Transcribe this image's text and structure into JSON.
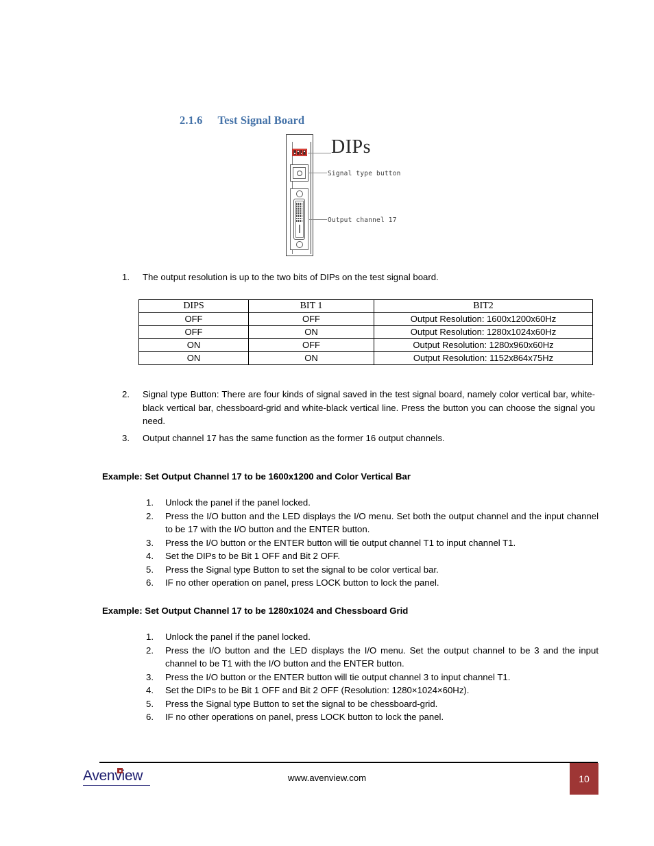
{
  "heading": {
    "number": "2.1.6",
    "title": "Test Signal Board"
  },
  "diagram": {
    "dips_title": "DIPs",
    "label_signal_button": "Signal type button",
    "label_output_channel": "Output channel 17"
  },
  "main_list": [
    {
      "marker": "1.",
      "text": "The output resolution is up to the two bits of DIPs on the test signal board."
    },
    {
      "marker": "2.",
      "text": "Signal type Button: There are four kinds of signal saved in the test signal board, namely color vertical bar, white-black vertical bar, chessboard-grid and white-black vertical line. Press the button you can choose the signal you need."
    },
    {
      "marker": "3.",
      "text": "Output channel 17 has the same function as the former 16 output channels."
    }
  ],
  "table": {
    "headers": [
      "DIPS",
      "BIT 1",
      "BIT2"
    ],
    "rows": [
      [
        "OFF",
        "OFF",
        "Output Resolution: 1600x1200x60Hz"
      ],
      [
        "OFF",
        "ON",
        "Output Resolution: 1280x1024x60Hz"
      ],
      [
        "ON",
        "OFF",
        "Output Resolution: 1280x960x60Hz"
      ],
      [
        "ON",
        "ON",
        "Output Resolution: 1152x864x75Hz"
      ]
    ]
  },
  "example1": {
    "heading": "Example: Set Output Channel 17 to be 1600x1200 and Color Vertical Bar",
    "steps": [
      {
        "marker": "1.",
        "text": "Unlock the panel if the panel locked."
      },
      {
        "marker": "2.",
        "text": "Press the I/O button and the LED displays the I/O menu. Set both the output channel and the input channel to be 17 with the I/O button and the ENTER button."
      },
      {
        "marker": "3.",
        "text": "Press the I/O button or the ENTER button will tie output channel T1 to input channel T1."
      },
      {
        "marker": "4.",
        "text": "Set the DIPs to be Bit 1 OFF and Bit 2 OFF."
      },
      {
        "marker": "5.",
        "text": "Press the Signal type Button to set the signal to be color vertical bar."
      },
      {
        "marker": "6.",
        "text": "IF no other operation on panel, press LOCK button to lock the panel."
      }
    ]
  },
  "example2": {
    "heading": "Example: Set Output Channel 17 to be 1280x1024 and Chessboard Grid",
    "steps": [
      {
        "marker": "1.",
        "text": "Unlock the panel if the panel locked."
      },
      {
        "marker": "2.",
        "text": "Press the I/O button and the LED displays the I/O menu. Set the output channel to be 3 and the input channel to be T1 with the I/O button and the ENTER button."
      },
      {
        "marker": "3.",
        "text": "Press the I/O button or the ENTER button will tie output channel 3 to input channel T1."
      },
      {
        "marker": "4.",
        "text": "Set the DIPs to be Bit 1 OFF and Bit 2 OFF (Resolution: 1280×1024×60Hz)."
      },
      {
        "marker": "5.",
        "text": "Press the Signal type Button to set the signal to be chessboard-grid."
      },
      {
        "marker": "6.",
        "text": "IF no other operations on panel, press LOCK button to lock the panel."
      }
    ]
  },
  "footer": {
    "logo_text": "Avenview",
    "url": "www.avenview.com",
    "page_number": "10",
    "badge_color": "#9e3635",
    "logo_color": "#1c1c6e",
    "heading_color": "#4472a8"
  }
}
